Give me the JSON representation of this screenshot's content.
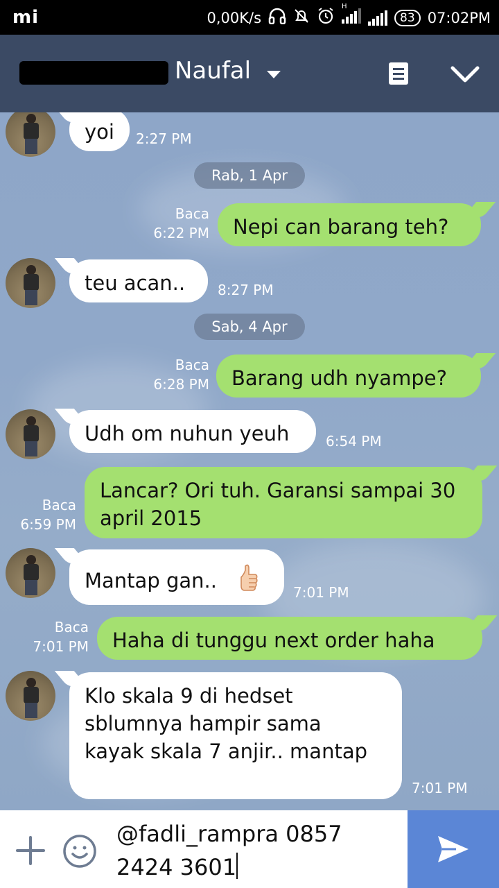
{
  "status_bar": {
    "logo": "mi",
    "speed": "0,00K/s",
    "network_label": "H",
    "battery": "83",
    "time": "07:02PM"
  },
  "header": {
    "contact_name": "Naufal"
  },
  "messages": [
    {
      "id": "m1",
      "direction": "in",
      "text": "yoi",
      "time": "2:27 PM"
    },
    {
      "id": "d1",
      "type": "date",
      "text": "Rab, 1 Apr"
    },
    {
      "id": "m2",
      "direction": "out",
      "text": "Nepi can barang teh?",
      "read": "Baca",
      "time": "6:22 PM"
    },
    {
      "id": "m3",
      "direction": "in",
      "text": "teu acan..",
      "time": "8:27 PM"
    },
    {
      "id": "d2",
      "type": "date",
      "text": "Sab, 4 Apr"
    },
    {
      "id": "m4",
      "direction": "out",
      "text": "Barang udh nyampe?",
      "read": "Baca",
      "time": "6:28 PM"
    },
    {
      "id": "m5",
      "direction": "in",
      "text": "Udh om nuhun yeuh",
      "time": "6:54 PM"
    },
    {
      "id": "m6",
      "direction": "out",
      "text": "Lancar? Ori tuh. Garansi sampai 30 april 2015",
      "read": "Baca",
      "time": "6:59 PM"
    },
    {
      "id": "m7",
      "direction": "in",
      "text": "Mantap gan..",
      "time": "7:01 PM",
      "emoji": "thumbs-up-icon"
    },
    {
      "id": "m8",
      "direction": "out",
      "text": "Haha di tunggu next order haha",
      "read": "Baca",
      "time": "7:01 PM"
    },
    {
      "id": "m9",
      "direction": "in",
      "text": "Klo skala 9 di hedset sblumnya hampir sama kayak skala 7 anjir.. mantap",
      "time": "7:01 PM"
    }
  ],
  "input": {
    "value": "@fadli_rampra 0857 2424 3601"
  },
  "colors": {
    "header_bg": "#3b4a64",
    "outgoing_bubble": "#a4e070",
    "incoming_bubble": "#ffffff",
    "send_button": "#5b86d6"
  }
}
